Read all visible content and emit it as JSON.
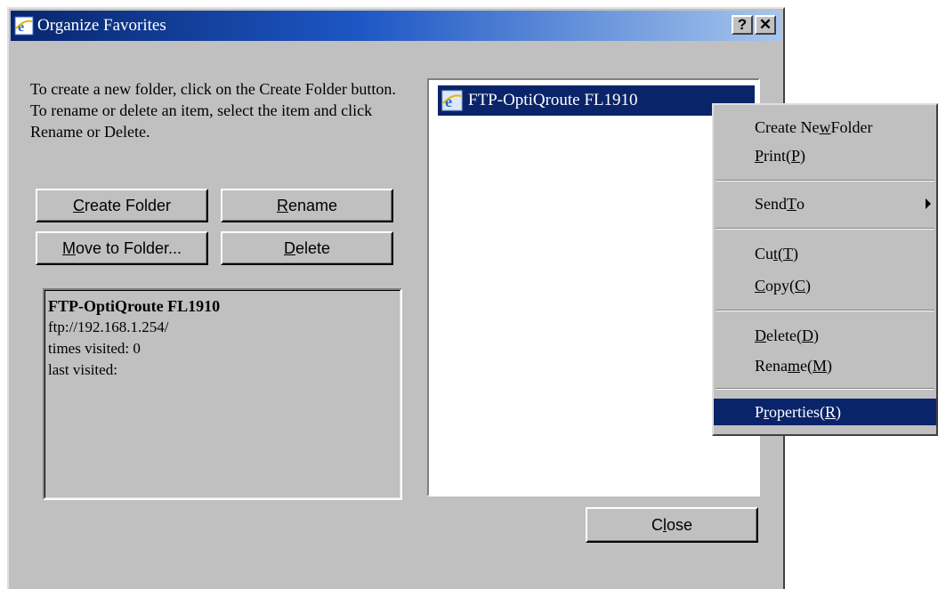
{
  "window": {
    "title": "Organize Favorites",
    "help_label": "?",
    "close_label": "✕"
  },
  "instructions": "To create a new folder, click on the Create Folder button. To rename or delete an item, select the item and click Rename or Delete.",
  "buttons": {
    "create_folder": {
      "pre": "",
      "key": "C",
      "post": "reate Folder"
    },
    "rename": {
      "pre": "",
      "key": "R",
      "post": "ename"
    },
    "move_to_folder": {
      "pre": "",
      "key": "M",
      "post": "ove to Folder..."
    },
    "delete": {
      "pre": "",
      "key": "D",
      "post": "elete"
    },
    "close": {
      "pre": "C",
      "key": "l",
      "post": "ose"
    }
  },
  "info": {
    "title": "FTP-OptiQroute FL1910",
    "url": "ftp://192.168.1.254/",
    "visits": "times visited: 0",
    "last": "last visited:"
  },
  "list": {
    "items": [
      {
        "label": "FTP-OptiQroute FL1910",
        "icon": "ie-icon",
        "selected": true
      }
    ]
  },
  "context_menu": {
    "create_new_folder": {
      "pre": "Create Ne",
      "key": "w",
      "post": " Folder"
    },
    "print": {
      "pre": "",
      "key": "P",
      "post": "rint",
      "acc_pre": "(",
      "acc_key": "P",
      "acc_post": ")"
    },
    "send_to": {
      "pre": "Send ",
      "key": "T",
      "post": "o"
    },
    "cut": {
      "pre": "Cu",
      "key": "t",
      "post": "",
      "acc_pre": "(",
      "acc_key": "T",
      "acc_post": ")"
    },
    "copy": {
      "pre": "",
      "key": "C",
      "post": "opy ",
      "acc_pre": "(",
      "acc_key": "C",
      "acc_post": ")"
    },
    "delete": {
      "pre": "",
      "key": "D",
      "post": "elete ",
      "acc_pre": "(",
      "acc_key": "D",
      "acc_post": ")"
    },
    "rename": {
      "pre": "Rena",
      "key": "m",
      "post": "e",
      "acc_pre": "(",
      "acc_key": "M",
      "acc_post": ")"
    },
    "properties": {
      "pre": "P",
      "key": "r",
      "post": "operties ",
      "acc_pre": "(",
      "acc_key": "R",
      "acc_post": ")"
    }
  },
  "colors": {
    "selection": "#0a246a",
    "dialog": "#c0c0c0",
    "titlebar_start": "#08266d",
    "titlebar_end": "#a6c6ee"
  }
}
